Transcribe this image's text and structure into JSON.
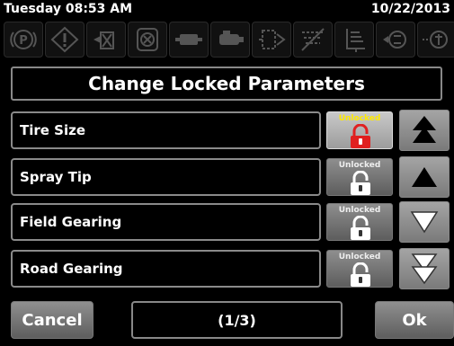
{
  "status_bar": {
    "datetime": "Tuesday 08:53 AM",
    "date": "10/22/2013"
  },
  "indicators": [
    {
      "icon": "parking-brake-icon"
    },
    {
      "icon": "warning-diamond-icon"
    },
    {
      "icon": "spray-valve-icon"
    },
    {
      "icon": "steering-lock-icon"
    },
    {
      "icon": "tank-icon"
    },
    {
      "icon": "pump-icon"
    },
    {
      "icon": "sensor-icon"
    },
    {
      "icon": "boom-disabled-icon"
    },
    {
      "icon": "fill-level-icon"
    },
    {
      "icon": "agitator-icon"
    },
    {
      "icon": "nozzle-icon"
    }
  ],
  "title": "Change Locked Parameters",
  "parameters": [
    {
      "label": "Tire Size",
      "lock_status": "Unlocked",
      "selected": true
    },
    {
      "label": "Spray Tip",
      "lock_status": "Unlocked",
      "selected": false
    },
    {
      "label": "Field Gearing",
      "lock_status": "Unlocked",
      "selected": false
    },
    {
      "label": "Road Gearing",
      "lock_status": "Unlocked",
      "selected": false
    }
  ],
  "navigation": {
    "arrows": [
      "page-up-icon",
      "up-arrow-icon",
      "down-arrow-icon",
      "page-down-icon"
    ]
  },
  "footer": {
    "cancel_label": "Cancel",
    "page_indicator": "(1/3)",
    "ok_label": "Ok"
  },
  "colors": {
    "background": "#000000",
    "button_gray": "#7a7a7a",
    "selected_lock_red": "#e02020",
    "selected_status_yellow": "#ffea00",
    "border_gray": "#888888"
  }
}
